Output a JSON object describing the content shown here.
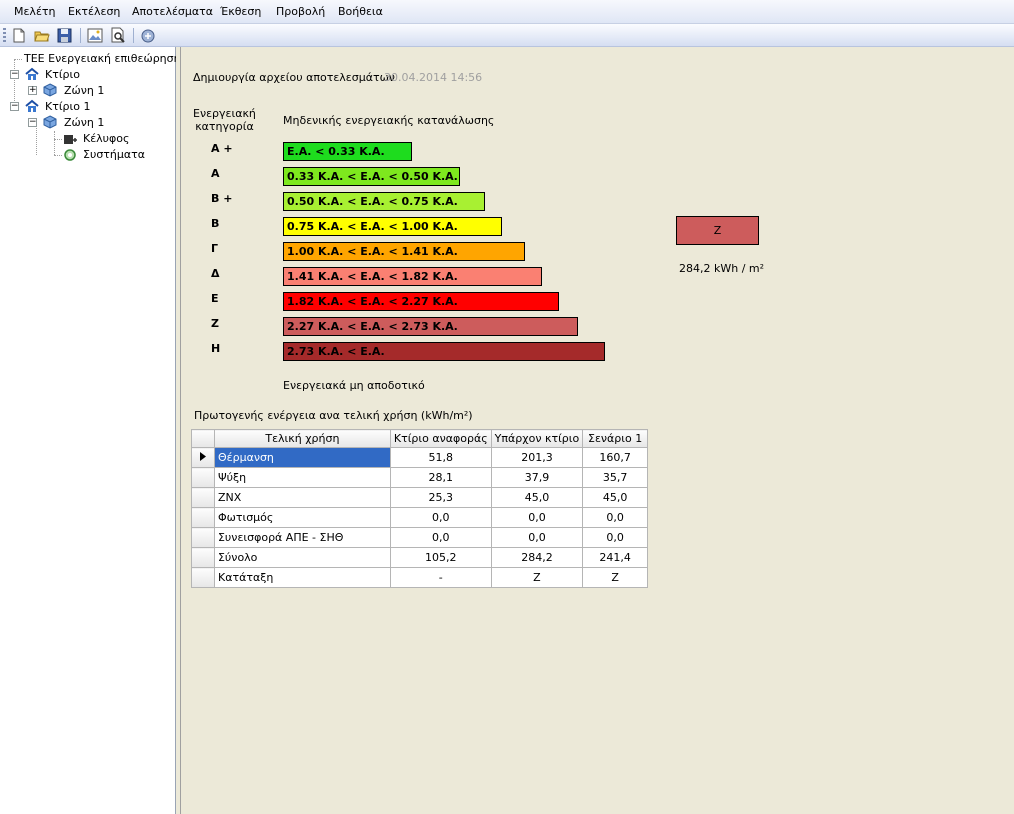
{
  "menu": {
    "items": [
      "Μελέτη",
      "Εκτέλεση",
      "Αποτελέσματα",
      "Έκθεση",
      "Προβολή",
      "Βοήθεια"
    ]
  },
  "toolbar": {
    "icons": [
      "new-file-icon",
      "open-folder-icon",
      "save-icon",
      "image-icon",
      "print-preview-icon",
      "export-icon"
    ]
  },
  "tree": {
    "root": "ΤΕΕ  Ενεργειακή επιθεώρηση",
    "building_ref": "Κτίριο",
    "zone_ref": "Ζώνη 1",
    "building": "Κτίριο 1",
    "zone": "Ζώνη 1",
    "shell": "Κέλυφος",
    "systems": "Συστήματα"
  },
  "header": {
    "label": "Δημιουργία αρχείου αποτελεσμάτων",
    "timestamp": "30.04.2014 14:56"
  },
  "scale": {
    "category_header": "Ενεργειακή\nκατηγορία",
    "top_label": "Μηδενικής ενεργειακής κατανάλωσης",
    "bottom_label": "Ενεργειακά μη αποδοτικό",
    "rows": [
      {
        "cat": "Α +",
        "range": "Ε.Α.  <  0.33 Κ.Α.",
        "color": "#1edc1e"
      },
      {
        "cat": "Α",
        "range": "0.33 Κ.Α.  <   Ε.Α.  <  0.50 Κ.Α.",
        "color": "#7ee81e"
      },
      {
        "cat": "Β +",
        "range": "0.50 Κ.Α.  <   Ε.Α.  <  0.75 Κ.Α.",
        "color": "#a8f032"
      },
      {
        "cat": "Β",
        "range": "0.75 Κ.Α.  <   Ε.Α.  <  1.00 Κ.Α.",
        "color": "#ffff00"
      },
      {
        "cat": "Γ",
        "range": "1.00 Κ.Α.  <   Ε.Α.  <  1.41 Κ.Α.",
        "color": "#ffa500"
      },
      {
        "cat": "Δ",
        "range": "1.41 Κ.Α.  <   Ε.Α.  <  1.82 Κ.Α.",
        "color": "#fa8072"
      },
      {
        "cat": "Ε",
        "range": "1.82 Κ.Α.  <   Ε.Α.  <  2.27 Κ.Α.",
        "color": "#ff0000"
      },
      {
        "cat": "Ζ",
        "range": "2.27 Κ.Α.  <   Ε.Α.  <  2.73 Κ.Α.",
        "color": "#cd5c5c"
      },
      {
        "cat": "Η",
        "range": "2.73 Κ.Α.  <   Ε.Α.",
        "color": "#a52a2a"
      }
    ]
  },
  "result": {
    "category": "Ζ",
    "value": "284,2 kWh / m²",
    "color": "#cd5c5c"
  },
  "table": {
    "title": "Πρωτογενής ενέργεια ανα τελική χρήση (kWh/m²)",
    "columns": [
      "Τελική χρήση",
      "Κτίριο αναφοράς",
      "Υπάρχον κτίριο",
      "Σενάριο 1"
    ],
    "rows": [
      [
        "Θέρμανση",
        "51,8",
        "201,3",
        "160,7"
      ],
      [
        "Ψύξη",
        "28,1",
        "37,9",
        "35,7"
      ],
      [
        "ΖΝΧ",
        "25,3",
        "45,0",
        "45,0"
      ],
      [
        "Φωτισμός",
        "0,0",
        "0,0",
        "0,0"
      ],
      [
        "Συνεισφορά ΑΠΕ - ΣΗΘ",
        "0,0",
        "0,0",
        "0,0"
      ],
      [
        "Σύνολο",
        "105,2",
        "284,2",
        "241,4"
      ],
      [
        "Κατάταξη",
        "-",
        "Ζ",
        "Ζ"
      ]
    ]
  }
}
